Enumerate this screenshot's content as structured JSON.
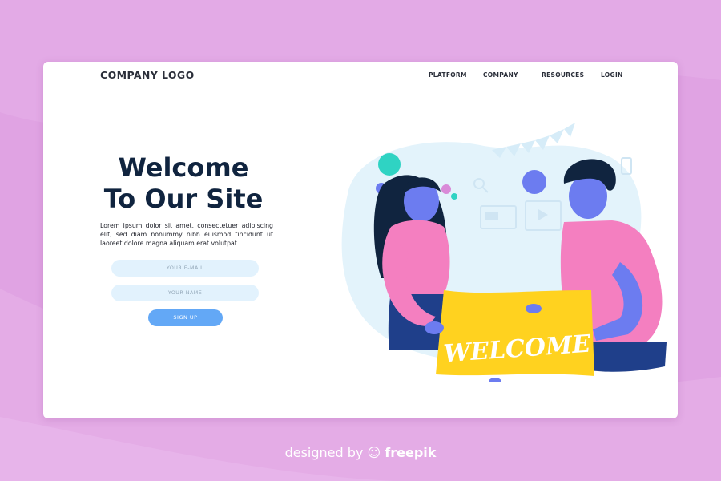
{
  "header": {
    "logo": "COMPANY LOGO",
    "nav": [
      "PLATFORM",
      "COMPANY",
      "RESOURCES",
      "LOGIN"
    ]
  },
  "hero": {
    "title_line1": "Welcome",
    "title_line2": "To Our Site",
    "body": "Lorem ipsum dolor sit amet, consectetuer adipiscing elit, sed diam nonummy nibh euismod tincidunt ut laoreet dolore magna aliquam erat volutpat."
  },
  "form": {
    "email_placeholder": "YOUR E-MAIL",
    "name_placeholder": "YOUR NAME",
    "signup_label": "SIGN UP"
  },
  "illustration": {
    "banner_text": "WELCOME"
  },
  "credit": {
    "prefix": "designed by",
    "brand": "freepik"
  },
  "colors": {
    "background": "#e0a3e3",
    "card": "#ffffff",
    "heading": "#10243f",
    "input": "#e2f2fd",
    "button": "#63a8f6",
    "banner": "#ffd21f",
    "shirt": "#f47fc0",
    "skin": "#6c7cf0"
  }
}
